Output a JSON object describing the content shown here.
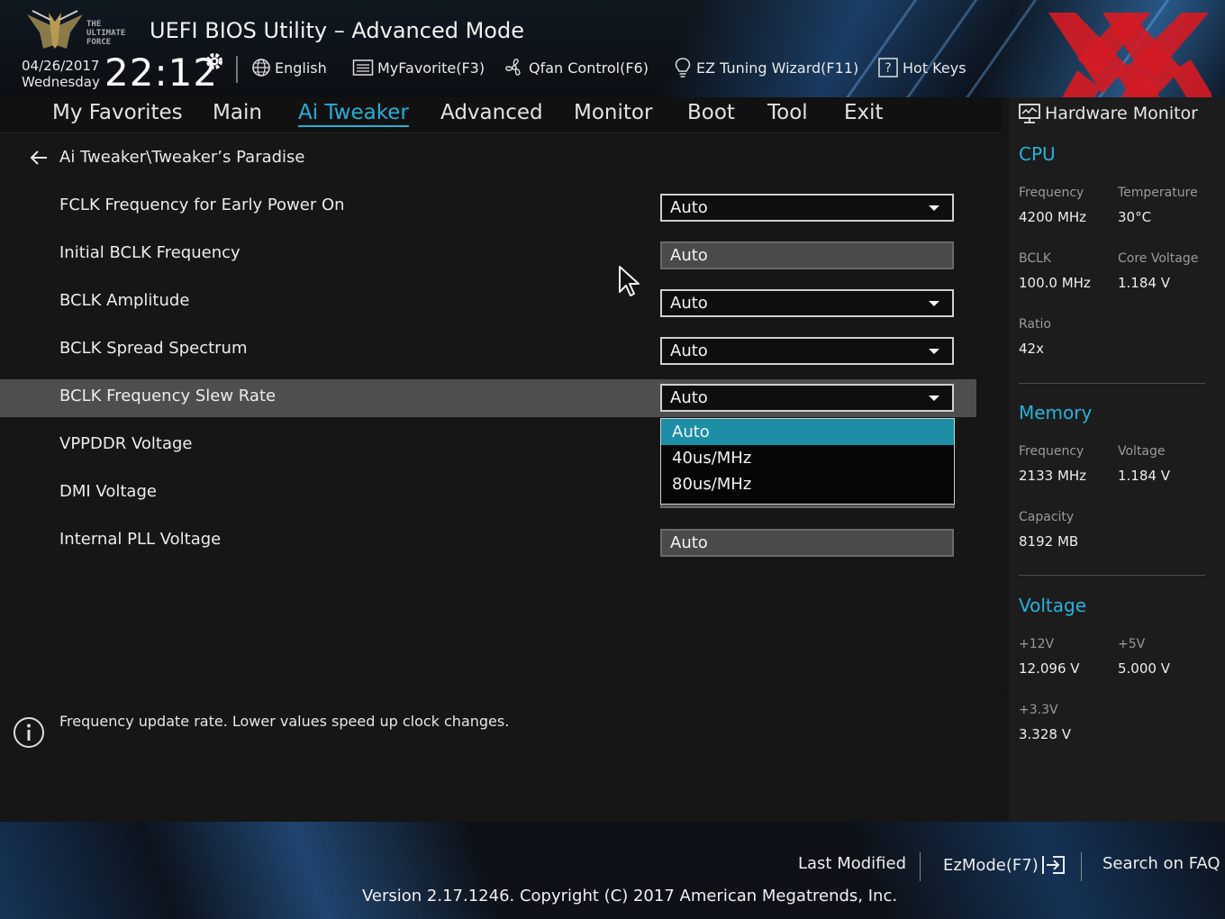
{
  "header": {
    "logo_text": [
      "THE",
      "ULTIMATE",
      "FORCE"
    ],
    "title": "UEFI BIOS Utility – Advanced Mode",
    "date": "04/26/2017",
    "weekday": "Wednesday",
    "time": "22:12",
    "items": [
      {
        "label": "English",
        "icon": "globe-icon"
      },
      {
        "label": "MyFavorite(F3)",
        "icon": "favorite-list-icon"
      },
      {
        "label": "Qfan Control(F6)",
        "icon": "fan-icon"
      },
      {
        "label": "EZ Tuning Wizard(F11)",
        "icon": "lightbulb-icon"
      },
      {
        "label": "Hot Keys",
        "icon": "help-icon"
      }
    ]
  },
  "nav": {
    "tabs": [
      {
        "label": "My Favorites"
      },
      {
        "label": "Main"
      },
      {
        "label": "Ai Tweaker",
        "active": true
      },
      {
        "label": "Advanced"
      },
      {
        "label": "Monitor"
      },
      {
        "label": "Boot"
      },
      {
        "label": "Tool"
      },
      {
        "label": "Exit"
      }
    ]
  },
  "main": {
    "breadcrumb": "Ai Tweaker\\Tweaker’s Paradise",
    "settings": [
      {
        "label": "FCLK Frequency for Early Power On",
        "value": "Auto",
        "kind": "dropdown"
      },
      {
        "label": "Initial BCLK Frequency",
        "value": "Auto",
        "kind": "input"
      },
      {
        "label": "BCLK Amplitude",
        "value": "Auto",
        "kind": "dropdown"
      },
      {
        "label": "BCLK Spread Spectrum",
        "value": "Auto",
        "kind": "dropdown"
      },
      {
        "label": "BCLK Frequency Slew Rate",
        "value": "Auto",
        "kind": "dropdown",
        "selected": true
      },
      {
        "label": "VPPDDR Voltage",
        "value": "",
        "kind": "hidden"
      },
      {
        "label": "DMI Voltage",
        "value": "",
        "kind": "hidden"
      },
      {
        "label": "Internal PLL Voltage",
        "value": "Auto",
        "kind": "input"
      }
    ],
    "dropdown_options": [
      "Auto",
      "40us/MHz",
      "80us/MHz"
    ],
    "dropdown_highlight": "Auto"
  },
  "info": {
    "text": "Frequency update rate. Lower values speed up clock changes."
  },
  "hwmon": {
    "title": "Hardware Monitor",
    "cpu": {
      "heading": "CPU",
      "frequency_label": "Frequency",
      "frequency": "4200 MHz",
      "temperature_label": "Temperature",
      "temperature": "30°C",
      "bclk_label": "BCLK",
      "bclk": "100.0 MHz",
      "core_voltage_label": "Core Voltage",
      "core_voltage": "1.184 V",
      "ratio_label": "Ratio",
      "ratio": "42x"
    },
    "memory": {
      "heading": "Memory",
      "frequency_label": "Frequency",
      "frequency": "2133 MHz",
      "voltage_label": "Voltage",
      "voltage": "1.184 V",
      "capacity_label": "Capacity",
      "capacity": "8192 MB"
    },
    "voltage": {
      "heading": "Voltage",
      "v12_label": "+12V",
      "v12": "12.096 V",
      "v5_label": "+5V",
      "v5": "5.000 V",
      "v33_label": "+3.3V",
      "v33": "3.328 V"
    }
  },
  "footer": {
    "last_modified": "Last Modified",
    "ezmode": "EzMode(F7)",
    "search_faq": "Search on FAQ",
    "version": "Version 2.17.1246. Copyright (C) 2017 American Megatrends, Inc."
  },
  "colors": {
    "accent": "#21b0d6",
    "highlight": "#1c8ea6",
    "watermark": "#d21b24"
  }
}
